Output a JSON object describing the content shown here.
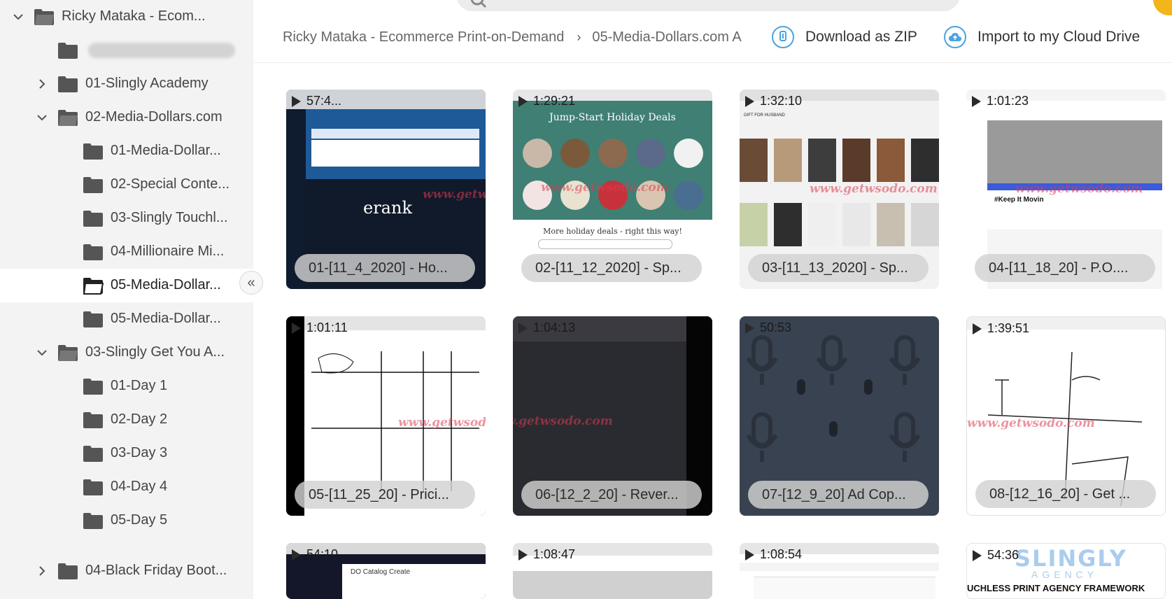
{
  "sidebar": {
    "items": [
      {
        "label": "Ricky Mataka - Ecom...",
        "expanded": true
      },
      {
        "label": "",
        "redacted": true
      },
      {
        "label": "01-Slingly Academy",
        "expanded": false
      },
      {
        "label": "02-Media-Dollars.com",
        "expanded": true
      },
      {
        "label": "01-Media-Dollar..."
      },
      {
        "label": "02-Special Conte..."
      },
      {
        "label": "03-Slingly Touchl..."
      },
      {
        "label": "04-Millionaire Mi..."
      },
      {
        "label": "05-Media-Dollar...",
        "selected": true
      },
      {
        "label": "05-Media-Dollar..."
      },
      {
        "label": "03-Slingly Get You A...",
        "expanded": true
      },
      {
        "label": "01-Day 1"
      },
      {
        "label": "02-Day 2"
      },
      {
        "label": "03-Day 3"
      },
      {
        "label": "04-Day 4"
      },
      {
        "label": "05-Day 5"
      },
      {
        "label": "04-Black Friday Boot...",
        "expanded": false
      }
    ],
    "collapse_glyph": "«"
  },
  "header": {
    "breadcrumb_root": "Ricky Mataka - Ecommerce Print-on-Demand",
    "breadcrumb_sep": "›",
    "breadcrumb_current": "05-Media-Dollars.com A",
    "download_label": "Download as ZIP",
    "import_label": "Import to my Cloud Drive"
  },
  "videos": [
    {
      "duration": "57:4...",
      "title": "01-[11_4_2020] - Ho..."
    },
    {
      "duration": "1:29:21",
      "title": "02-[11_12_2020] - Sp..."
    },
    {
      "duration": "1:32:10",
      "title": "03-[11_13_2020] - Sp..."
    },
    {
      "duration": "1:01:23",
      "title": "04-[11_18_20] - P.O...."
    },
    {
      "duration": "1:01:11",
      "title": "05-[11_25_20] - Prici..."
    },
    {
      "duration": "1:04:13",
      "title": "06-[12_2_20] - Rever..."
    },
    {
      "duration": "50:53",
      "title": "07-[12_9_20] Ad Cop..."
    },
    {
      "duration": "1:39:51",
      "title": "08-[12_16_20] - Get ..."
    },
    {
      "duration": "54:10",
      "title": ""
    },
    {
      "duration": "1:08:47",
      "title": ""
    },
    {
      "duration": "1:08:54",
      "title": ""
    },
    {
      "duration": "54:36",
      "title": ""
    }
  ],
  "thumb_text": {
    "erank_logo": "erank",
    "holiday_heading": "Jump-Start Holiday Deals",
    "holiday_more": "More holiday deals - right this way!",
    "gift_search": "GIFT FOR HUSBAND",
    "keep_it_movin": "#Keep It Movin",
    "catalog_create": "DO Catalog Create",
    "slingly_logo": "SLINGLY",
    "slingly_sub": "AGENCY",
    "framework_text": "UCHLESS PRINT AGENCY FRAMEWORK",
    "watermark": "www.getwsodo.com"
  },
  "colors": {
    "accent_blue": "#4aa3df",
    "sidebar_bg": "#f3f3f3",
    "folder_icon": "#555555",
    "orange_avatar": "#f2b51a"
  }
}
